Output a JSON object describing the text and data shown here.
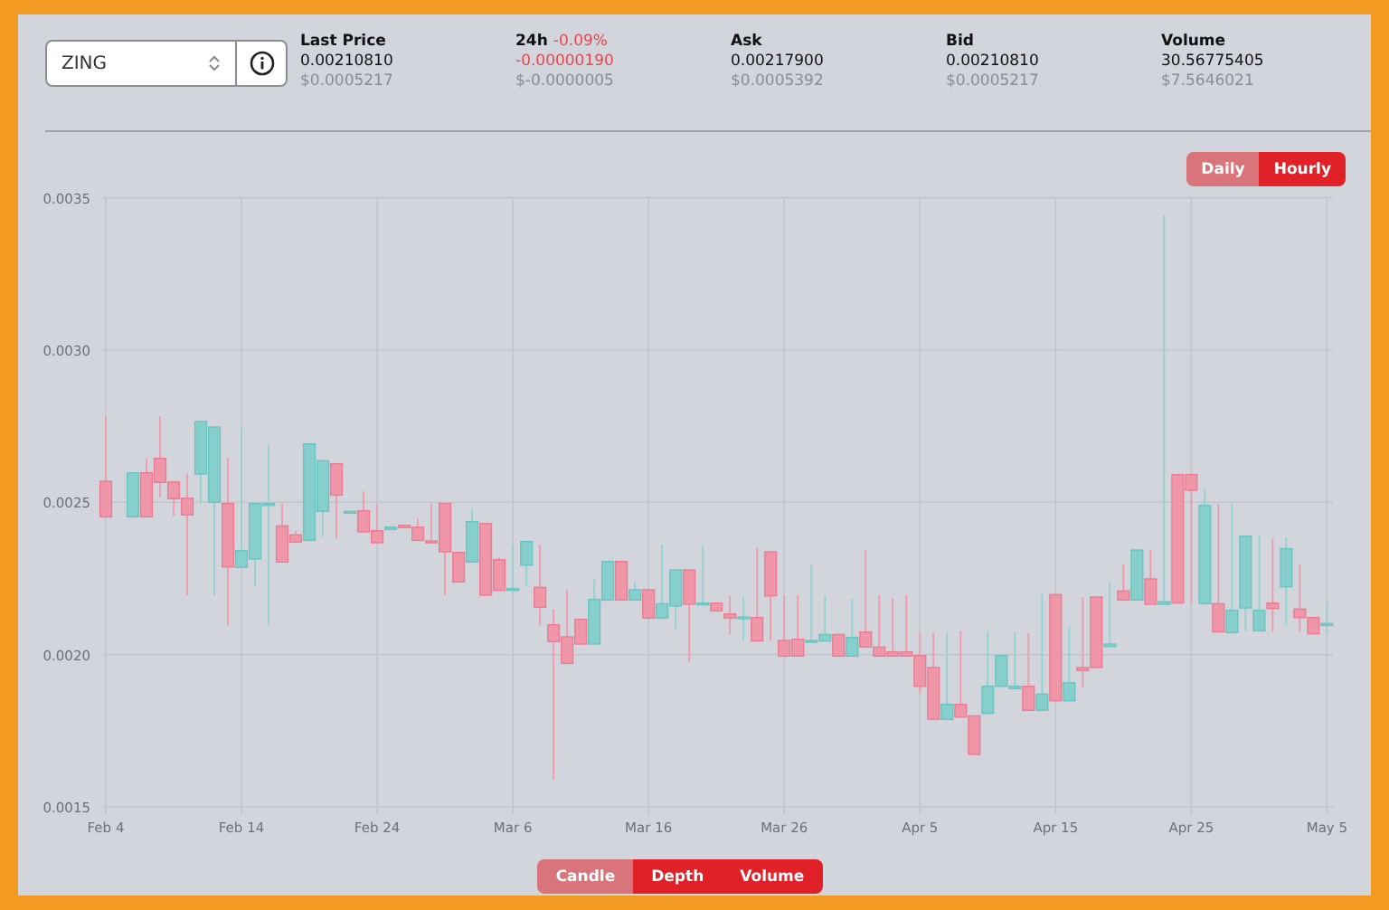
{
  "symbol_select": {
    "value": "ZING"
  },
  "stats": [
    {
      "label": "Last Price",
      "value": "0.00210810",
      "usd": "$0.0005217",
      "negative": false
    },
    {
      "label": "24h",
      "change": "-0.09%",
      "value": "-0.00000190",
      "usd": "$-0.0000005",
      "negative": true
    },
    {
      "label": "Ask",
      "value": "0.00217900",
      "usd": "$0.0005392",
      "negative": false
    },
    {
      "label": "Bid",
      "value": "0.00210810",
      "usd": "$0.0005217",
      "negative": false
    },
    {
      "label": "Volume",
      "value": "30.56775405",
      "usd": "$7.5646021",
      "negative": false
    }
  ],
  "interval_toggle": [
    {
      "label": "Daily",
      "selected": true
    },
    {
      "label": "Hourly",
      "selected": false
    }
  ],
  "chart": {
    "chart_data": {
      "type": "candlestick",
      "categories": [
        "Feb 4",
        null,
        null,
        null,
        null,
        null,
        null,
        null,
        null,
        null,
        "Feb 14",
        null,
        null,
        null,
        null,
        null,
        null,
        null,
        null,
        null,
        "Feb 24",
        null,
        null,
        null,
        null,
        null,
        null,
        null,
        null,
        null,
        "Mar 6",
        null,
        null,
        null,
        null,
        null,
        null,
        null,
        null,
        null,
        "Mar 16",
        null,
        null,
        null,
        null,
        null,
        null,
        null,
        null,
        null,
        "Mar 26",
        null,
        null,
        null,
        null,
        null,
        null,
        null,
        null,
        null,
        "Apr 5",
        null,
        null,
        null,
        null,
        null,
        null,
        null,
        null,
        null,
        "Apr 15",
        null,
        null,
        null,
        null,
        null,
        null,
        null,
        null,
        null,
        "Apr 25",
        null,
        null,
        null,
        null,
        null,
        null,
        null,
        null,
        null,
        "May 5"
      ],
      "ohlc": [
        [
          0.0025692,
          0.002783,
          0.0024523,
          0.0024523
        ],
        null,
        [
          0.0024523,
          0.0025969,
          0.0024523,
          0.0025969
        ],
        [
          0.0025969,
          0.0026444,
          0.0024523,
          0.0024523
        ],
        [
          0.0026444,
          0.002783,
          0.0025157,
          0.0025652
        ],
        [
          0.0025672,
          0.0025672,
          0.0024563,
          0.0025117
        ],
        [
          0.0025137,
          0.0025949,
          0.0021949,
          0.0024583
        ],
        [
          0.0025929,
          0.0027652,
          0.0024939,
          0.0027652
        ],
        [
          0.0024999,
          0.0027474,
          0.0021949,
          0.0027474
        ],
        [
          0.0024959,
          0.0026464,
          0.0020959,
          0.002288
        ],
        [
          0.002286,
          0.0027454,
          0.002286,
          0.0023415
        ],
        [
          0.0023137,
          0.0024959,
          0.0022246,
          0.0024959
        ],
        [
          0.0024919,
          0.0026899,
          0.0020959,
          0.0024959
        ],
        [
          0.0024226,
          0.0024959,
          0.0023038,
          0.0023038
        ],
        [
          0.0023929,
          0.0024068,
          0.0023692,
          0.0023692
        ],
        [
          0.0023751,
          0.0026919,
          0.0023751,
          0.0026919
        ],
        [
          0.0024702,
          0.0026365,
          0.002387,
          0.0026365
        ],
        [
          0.0026266,
          0.0026266,
          0.0023811,
          0.0025236
        ],
        [
          0.0024642,
          0.0024702,
          0.0024642,
          0.0024702
        ],
        [
          0.0024721,
          0.0025355,
          0.0024028,
          0.0024028
        ],
        [
          0.0024068,
          0.0024959,
          0.0023672,
          0.0023672
        ],
        [
          0.0024108,
          0.0024187,
          0.0024108,
          0.0024187
        ],
        [
          0.0024246,
          0.0024246,
          0.0024167,
          0.0024167
        ],
        [
          0.0024187,
          0.0024464,
          0.0023751,
          0.0023751
        ],
        [
          0.0023731,
          0.0024959,
          0.0023692,
          0.0023692
        ],
        [
          0.0024959,
          0.0024959,
          0.0021949,
          0.0023375
        ],
        [
          0.0023355,
          0.0023355,
          0.0022385,
          0.0022385
        ],
        [
          0.0023038,
          0.0024801,
          0.0023038,
          0.0024365
        ],
        [
          0.0024306,
          0.0024306,
          0.0021949,
          0.0021949
        ],
        [
          0.0023118,
          0.0023177,
          0.0022108,
          0.0022108
        ],
        [
          0.0022108,
          0.0023613,
          0.0022108,
          0.0022167
        ],
        [
          0.0022939,
          0.0023712,
          0.0022227,
          0.0023712
        ],
        [
          0.0022207,
          0.0023613,
          0.0020959,
          0.0021553
        ],
        [
          0.0020979,
          0.0021494,
          0.0015891,
          0.0020425
        ],
        [
          0.0020583,
          0.0022147,
          0.0019712,
          0.0019712
        ],
        [
          0.0021157,
          0.0021157,
          0.0020346,
          0.0020346
        ],
        [
          0.0020346,
          0.0022464,
          0.0020346,
          0.0021811
        ],
        [
          0.0021791,
          0.0023058,
          0.0021791,
          0.0023058
        ],
        [
          0.0023058,
          0.0023058,
          0.0021791,
          0.0021791
        ],
        [
          0.0021791,
          0.0022385,
          0.0021791,
          0.0022128
        ],
        [
          0.0022128,
          0.0022128,
          0.0021197,
          0.0021197
        ],
        [
          0.0021197,
          0.0023613,
          0.0021197,
          0.0021672
        ],
        [
          0.0021593,
          0.0022781,
          0.0020841,
          0.0022781
        ],
        [
          0.0022781,
          0.0022781,
          0.0019752,
          0.0021652
        ],
        [
          0.0021633,
          0.0023573,
          0.0021633,
          0.0021692
        ],
        [
          0.0021692,
          0.0021692,
          0.0021435,
          0.0021435
        ],
        [
          0.0021336,
          0.002193,
          0.0020662,
          0.0021197
        ],
        [
          0.0021177,
          0.002189,
          0.0020464,
          0.0021237
        ],
        [
          0.0021217,
          0.0023494,
          0.0020445,
          0.0020445
        ],
        [
          0.0023375,
          0.0023375,
          0.0020445,
          0.002193
        ],
        [
          0.0020464,
          0.0021949,
          0.001995,
          0.001995
        ],
        [
          0.0020504,
          0.0021949,
          0.001995,
          0.001995
        ],
        [
          0.0020425,
          0.0022939,
          0.0020425,
          0.0020464
        ],
        [
          0.0020445,
          0.002193,
          0.0020445,
          0.0020662
        ],
        [
          0.0020662,
          0.0020662,
          0.001995,
          0.001995
        ],
        [
          0.001995,
          0.0021831,
          0.001995,
          0.0020563
        ],
        [
          0.0020742,
          0.0023434,
          0.0020247,
          0.0020247
        ],
        [
          0.0020247,
          0.0021949,
          0.001995,
          0.001995
        ],
        [
          0.0020088,
          0.002185,
          0.001995,
          0.001995
        ],
        [
          0.0020088,
          0.0021949,
          0.001995,
          0.001995
        ],
        [
          0.0019969,
          0.0020742,
          0.0018722,
          0.001896
        ],
        [
          0.0019573,
          0.0020742,
          0.0017871,
          0.0017871
        ],
        [
          0.0017871,
          0.0020702,
          0.0017871,
          0.0018366
        ],
        [
          0.0018366,
          0.0020781,
          0.001795,
          0.001795
        ],
        [
          0.0017989,
          0.0017989,
          0.0016722,
          0.0016722
        ],
        [
          0.0018069,
          0.0020781,
          0.0018069,
          0.001896
        ],
        [
          0.001896,
          0.0019969,
          0.001896,
          0.0019969
        ],
        [
          0.001888,
          0.0020742,
          0.001888,
          0.001896
        ],
        [
          0.001896,
          0.0020702,
          0.0018168,
          0.0018168
        ],
        [
          0.0018168,
          0.0021989,
          0.0018168,
          0.0018702
        ],
        [
          0.0021969,
          0.0021969,
          0.0018484,
          0.0018484
        ],
        [
          0.0018484,
          0.002094,
          0.0018484,
          0.0019078
        ],
        [
          0.0019573,
          0.002189,
          0.00189,
          0.0019474
        ],
        [
          0.002189,
          0.002189,
          0.0019573,
          0.0019573
        ],
        [
          0.0020266,
          0.0022425,
          0.0020266,
          0.0020346
        ],
        [
          0.0022088,
          0.0022959,
          0.0021791,
          0.0021791
        ],
        [
          0.0021791,
          0.0023434,
          0.0021791,
          0.0023434
        ],
        [
          0.0022484,
          0.0023434,
          0.0021652,
          0.0021652
        ],
        [
          0.0021652,
          0.0034443,
          0.0021652,
          0.0021732
        ],
        [
          0.0025909,
          0.0025909,
          0.0021692,
          0.0021692
        ],
        [
          0.0025909,
          0.0025909,
          0.0021692,
          0.0025395
        ],
        [
          0.0021672,
          0.0025454,
          0.0021672,
          0.00249
        ],
        [
          0.0021672,
          0.0024939,
          0.0020742,
          0.0020742
        ],
        [
          0.0020722,
          0.0024939,
          0.0020722,
          0.0021454
        ],
        [
          0.0021534,
          0.002389,
          0.0020781,
          0.002389
        ],
        [
          0.0020781,
          0.002391,
          0.0020781,
          0.0021454
        ],
        [
          0.0021692,
          0.0023811,
          0.0020742,
          0.0021514
        ],
        [
          0.0022227,
          0.002385,
          0.0020959,
          0.0023474
        ],
        [
          0.0021494,
          0.0022959,
          0.0020742,
          0.0021217
        ],
        [
          0.0021217,
          0.0021217,
          0.0020682,
          0.0020682
        ],
        [
          0.0020959,
          0.0021751,
          0.0020662,
          0.0021019
        ]
      ],
      "ylim": [
        0.0015,
        0.0035
      ],
      "grid": true,
      "yticks": [
        {
          "value": 0.0035,
          "label": "0.0035"
        },
        {
          "value": 0.003,
          "label": "0.0030"
        },
        {
          "value": 0.0025,
          "label": "0.0025"
        },
        {
          "value": 0.002,
          "label": "0.0020"
        },
        {
          "value": 0.0015,
          "label": "0.0015"
        }
      ]
    }
  },
  "view_toggle": [
    {
      "label": "Candle",
      "selected": true
    },
    {
      "label": "Depth",
      "selected": false
    },
    {
      "label": "Volume",
      "selected": false
    }
  ]
}
